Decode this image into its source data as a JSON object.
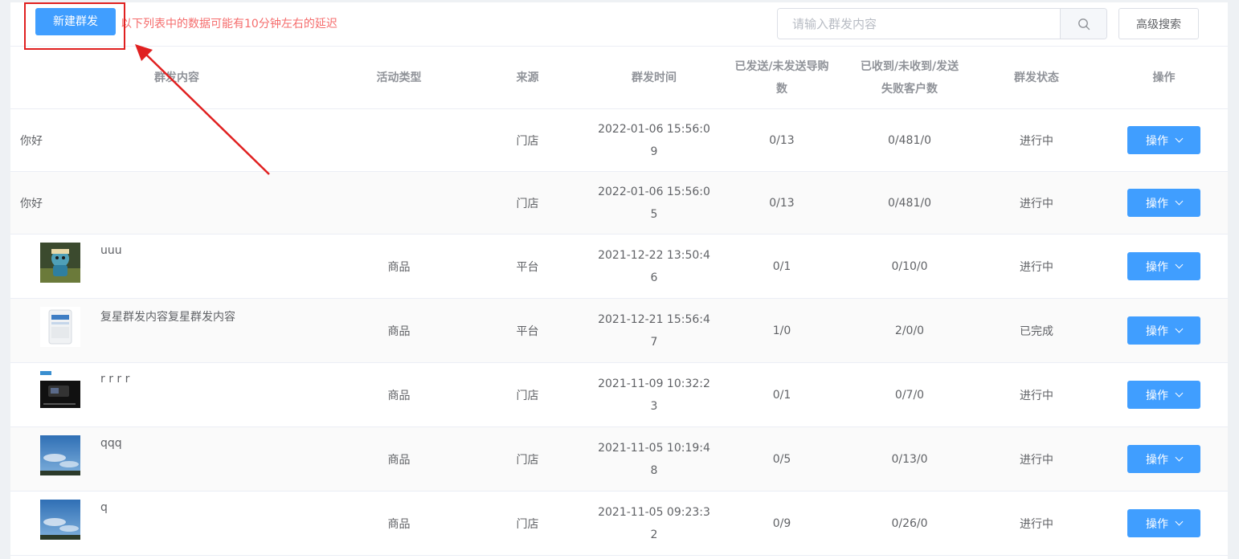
{
  "toolbar": {
    "new_button": "新建群发",
    "notice": "以下列表中的数据可能有10分钟左右的延迟",
    "search_placeholder": "请输入群发内容",
    "advanced_search": "高级搜索"
  },
  "table": {
    "columns": {
      "content": "群发内容",
      "type": "活动类型",
      "source": "来源",
      "time": "群发时间",
      "sent_line1": "已发送/未发送导购",
      "sent_line2": "数",
      "recv_line1": "已收到/未收到/发送",
      "recv_line2": "失败客户数",
      "status": "群发状态",
      "op": "操作"
    },
    "rows": [
      {
        "content": "你好",
        "thumb": "",
        "type": "",
        "source": "门店",
        "time_a": "2022-01-06 15:56:0",
        "time_b": "9",
        "sent": "0/13",
        "recv": "0/481/0",
        "status": "进行中",
        "op": "操作"
      },
      {
        "content": "你好",
        "thumb": "",
        "type": "",
        "source": "门店",
        "time_a": "2022-01-06 15:56:0",
        "time_b": "5",
        "sent": "0/13",
        "recv": "0/481/0",
        "status": "进行中",
        "op": "操作"
      },
      {
        "content": "uuu",
        "thumb": "figure",
        "type": "商品",
        "source": "平台",
        "time_a": "2021-12-22 13:50:4",
        "time_b": "6",
        "sent": "0/1",
        "recv": "0/10/0",
        "status": "进行中",
        "op": "操作"
      },
      {
        "content": "复星群发内容复星群发内容",
        "thumb": "box",
        "type": "商品",
        "source": "平台",
        "time_a": "2021-12-21 15:56:4",
        "time_b": "7",
        "sent": "1/0",
        "recv": "2/0/0",
        "status": "已完成",
        "op": "操作"
      },
      {
        "content": "r r r r",
        "thumb": "device",
        "type": "商品",
        "source": "门店",
        "time_a": "2021-11-09 10:32:2",
        "time_b": "3",
        "sent": "0/1",
        "recv": "0/7/0",
        "status": "进行中",
        "op": "操作"
      },
      {
        "content": "qqq",
        "thumb": "sky",
        "type": "商品",
        "source": "门店",
        "time_a": "2021-11-05 10:19:4",
        "time_b": "8",
        "sent": "0/5",
        "recv": "0/13/0",
        "status": "进行中",
        "op": "操作"
      },
      {
        "content": "q",
        "thumb": "sky",
        "type": "商品",
        "source": "门店",
        "time_a": "2021-11-05 09:23:3",
        "time_b": "2",
        "sent": "0/9",
        "recv": "0/26/0",
        "status": "进行中",
        "op": "操作"
      }
    ]
  },
  "colors": {
    "primary": "#409eff",
    "notice_red": "#f56c6c",
    "annotation_red": "#e02020"
  }
}
